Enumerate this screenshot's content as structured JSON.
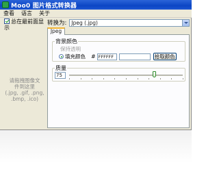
{
  "window": {
    "title": "Moo0 图片格式转换器"
  },
  "menu": [
    "查看",
    "语言",
    "关于"
  ],
  "sidebar": {
    "topmost_label": "总在最前面显示",
    "topmost_checked": true,
    "drop_hint_line1": "请拖拽图像文",
    "drop_hint_line2": "件到这里",
    "drop_hint_line3": "(.jpg, .gif, .png,",
    "drop_hint_line4": ".bmp, .ico)"
  },
  "convert": {
    "label": "转换为:",
    "selected_format": "Jpeg (.jpg)"
  },
  "tabs": [
    {
      "label": "Jpeg",
      "active": true
    }
  ],
  "background": {
    "title": "背景颜色",
    "keep_transparent_label": "保持透明",
    "fill_label": "填充颜色",
    "fill_selected": true,
    "hash": "#",
    "hex_value": "FFFFFF",
    "swatch_color": "#ffffff",
    "pick_button_label": "拾取颜色"
  },
  "quality": {
    "title": "质量",
    "value": "75",
    "slider_fraction": 0.75
  }
}
